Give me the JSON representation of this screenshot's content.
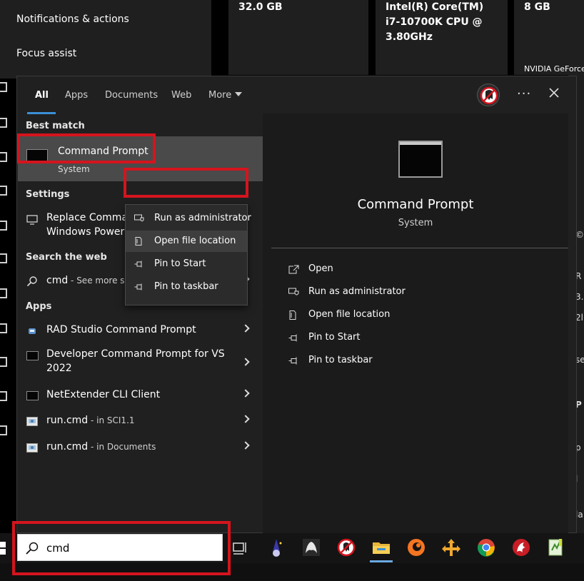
{
  "background": {
    "nav_items": [
      "Notifications & actions",
      "Focus assist"
    ],
    "tiles": [
      {
        "lines": [
          "32.0 GB"
        ]
      },
      {
        "lines": [
          "Intel(R) Core(TM)",
          "i7-10700K CPU @",
          "3.80GHz"
        ]
      },
      {
        "lines": [
          "8 GB"
        ],
        "footer": "NVIDIA GeForce"
      }
    ],
    "right_chars": [
      "©",
      "R",
      "3.",
      "2l",
      "se",
      "P",
      "p",
      "l",
      "la"
    ]
  },
  "start_menu": {
    "tabs": [
      "All",
      "Apps",
      "Documents",
      "Web",
      "More"
    ],
    "active_tab": "All",
    "more_options_glyph": "···",
    "best_match_heading": "Best match",
    "best_match": {
      "title": "Command Prompt",
      "subtitle": "System",
      "icon": "command-prompt-icon"
    },
    "settings_heading": "Settings",
    "settings_item": {
      "line1": "Replace Command",
      "line2": "Windows PowerS",
      "icon": "monitor-icon"
    },
    "web_heading": "Search the web",
    "web_item": {
      "query": "cmd",
      "suffix": " - See more search results",
      "icon": "search-icon"
    },
    "apps_heading": "Apps",
    "apps": [
      {
        "label": "RAD Studio Command Prompt",
        "sub": "",
        "icon": "rad-studio-icon"
      },
      {
        "label": "Developer Command Prompt for VS",
        "label2": "2022",
        "sub": "",
        "icon": "command-prompt-icon"
      },
      {
        "label": "NetExtender CLI Client",
        "sub": "",
        "icon": "command-prompt-icon"
      },
      {
        "label": "run.cmd",
        "sub": " - in SCI1.1",
        "icon": "batch-file-icon"
      },
      {
        "label": "run.cmd",
        "sub": " - in Documents",
        "icon": "batch-file-icon"
      }
    ],
    "context_menu": [
      {
        "label": "Run as administrator",
        "icon": "shield-icon"
      },
      {
        "label": "Open file location",
        "icon": "file-location-icon"
      },
      {
        "label": "Pin to Start",
        "icon": "pin-icon"
      },
      {
        "label": "Pin to taskbar",
        "icon": "pin-icon"
      }
    ],
    "preview": {
      "title": "Command Prompt",
      "subtitle": "System",
      "actions": [
        {
          "label": "Open",
          "icon": "open-icon"
        },
        {
          "label": "Run as administrator",
          "icon": "shield-icon"
        },
        {
          "label": "Open file location",
          "icon": "file-location-icon"
        },
        {
          "label": "Pin to Start",
          "icon": "pin-icon"
        },
        {
          "label": "Pin to taskbar",
          "icon": "pin-icon"
        }
      ]
    }
  },
  "taskbar": {
    "search_value": "cmd",
    "apps": [
      "task-view-icon",
      "wizard-app-icon",
      "white-creature-app-icon",
      "ghost-avatar-app-icon",
      "file-explorer-icon",
      "crunchyroll-icon",
      "arrows-app-icon",
      "chrome-icon",
      "red-dragon-app-icon",
      "notepad-plus-icon"
    ]
  },
  "colors": {
    "annotation_red": "#d4141e",
    "accent_blue": "#3b8fd6"
  }
}
